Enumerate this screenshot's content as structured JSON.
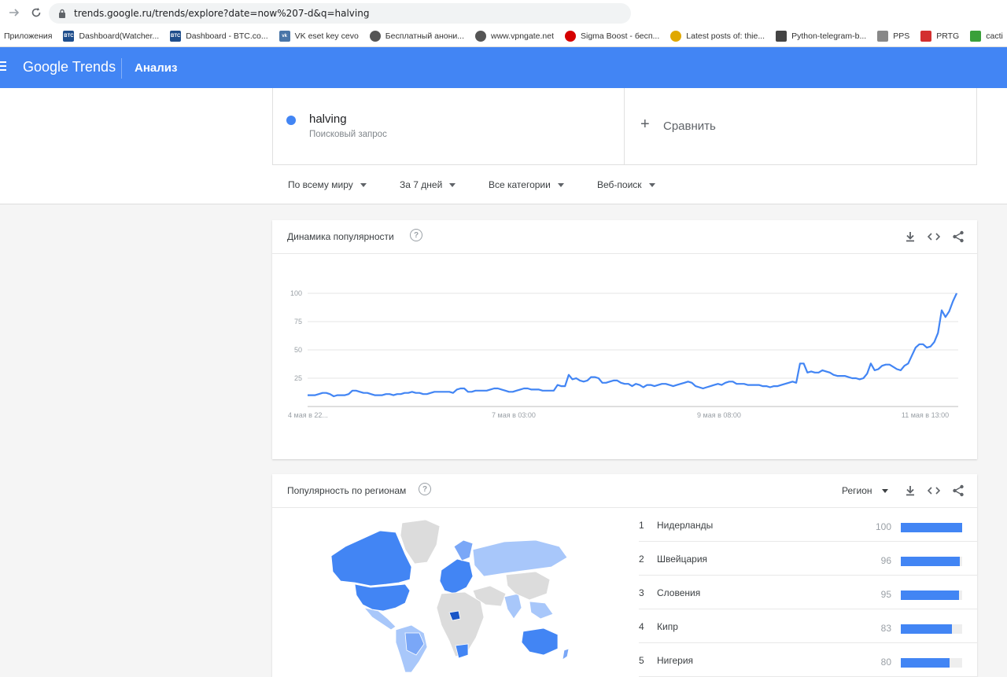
{
  "browser": {
    "url": "trends.google.ru/trends/explore?date=now%207-d&q=halving",
    "bookmarks": [
      {
        "label": "Приложения",
        "icon": "apps-icon",
        "color": ""
      },
      {
        "label": "Dashboard(Watcher...",
        "icon": "btc-icon",
        "color": "#1f4e8c"
      },
      {
        "label": "Dashboard - BTC.co...",
        "icon": "btc-icon",
        "color": "#1f4e8c"
      },
      {
        "label": "VK eset key cevo",
        "icon": "vk-icon",
        "color": "#4a76a8"
      },
      {
        "label": "Бесплатный анони...",
        "icon": "globe-icon",
        "color": "#333333"
      },
      {
        "label": "www.vpngate.net",
        "icon": "globe-icon",
        "color": "#333333"
      },
      {
        "label": "Sigma Boost - бесп...",
        "icon": "record-icon",
        "color": "#d50000"
      },
      {
        "label": "Latest posts of: thie...",
        "icon": "coin-icon",
        "color": "#e0a800"
      },
      {
        "label": "Python-telegram-b...",
        "icon": "road-icon",
        "color": "#444444"
      },
      {
        "label": "PPS",
        "icon": "gauge-icon",
        "color": "#888888"
      },
      {
        "label": "PRTG",
        "icon": "gauge-icon",
        "color": "#d32f2f"
      },
      {
        "label": "cacti",
        "icon": "cacti-icon",
        "color": "#3aa03a"
      }
    ]
  },
  "header": {
    "logo": "Google Trends",
    "section": "Анализ"
  },
  "search_term": {
    "name": "halving",
    "subtitle": "Поисковый запрос",
    "color": "#4285f4"
  },
  "compare": {
    "label": "Сравнить"
  },
  "filters": [
    "По всему миру",
    "За 7 дней",
    "Все категории",
    "Веб-поиск"
  ],
  "interest_card": {
    "title": "Динамика популярности"
  },
  "chart_data": {
    "type": "line",
    "title": "",
    "xlabel": "",
    "ylabel": "",
    "ylim": [
      0,
      100
    ],
    "yticks": [
      25,
      50,
      75,
      100
    ],
    "xtick_labels": [
      "4 мая в 22...",
      "7 мая в 03:00",
      "9 мая в 08:00",
      "11 мая в 13:00"
    ],
    "grid": true,
    "color": "#4285f4",
    "series": [
      {
        "values": [
          10,
          10,
          10,
          11,
          12,
          12,
          11,
          9,
          10,
          10,
          10,
          11,
          14,
          14,
          13,
          12,
          12,
          11,
          10,
          10,
          10,
          11,
          11,
          10,
          11,
          11,
          12,
          12,
          13,
          12,
          12,
          11,
          11,
          12,
          13,
          13,
          13,
          13,
          13,
          12,
          15,
          16,
          16,
          13,
          13,
          14,
          14,
          14,
          14,
          15,
          16,
          16,
          15,
          14,
          13,
          13,
          14,
          15,
          16,
          16,
          15,
          15,
          15,
          14,
          14,
          14,
          14,
          19,
          18,
          18,
          28,
          24,
          25,
          23,
          22,
          23,
          26,
          26,
          25,
          21,
          21,
          22,
          23,
          23,
          21,
          20,
          20,
          18,
          20,
          19,
          17,
          19,
          19,
          18,
          19,
          20,
          20,
          19,
          18,
          19,
          20,
          21,
          22,
          21,
          18,
          17,
          16,
          17,
          18,
          19,
          20,
          19,
          21,
          22,
          22,
          20,
          20,
          20,
          19,
          19,
          19,
          19,
          18,
          18,
          17,
          18,
          18,
          19,
          20,
          21,
          22,
          21,
          38,
          38,
          30,
          31,
          30,
          30,
          32,
          31,
          30,
          28,
          27,
          27,
          27,
          26,
          25,
          25,
          24,
          25,
          29,
          38,
          32,
          33,
          36,
          37,
          37,
          35,
          33,
          32,
          36,
          38,
          45,
          52,
          55,
          55,
          52,
          53,
          57,
          65,
          85,
          79,
          84,
          93,
          100
        ]
      }
    ]
  },
  "region_card": {
    "title": "Популярность по регионам",
    "select_label": "Регион",
    "regions": [
      {
        "rank": "1",
        "name": "Нидерланды",
        "value": "100",
        "level": 100
      },
      {
        "rank": "2",
        "name": "Швейцария",
        "value": "96",
        "level": 96
      },
      {
        "rank": "3",
        "name": "Словения",
        "value": "95",
        "level": 95
      },
      {
        "rank": "4",
        "name": "Кипр",
        "value": "83",
        "level": 83
      },
      {
        "rank": "5",
        "name": "Нигерия",
        "value": "80",
        "level": 80
      }
    ]
  }
}
